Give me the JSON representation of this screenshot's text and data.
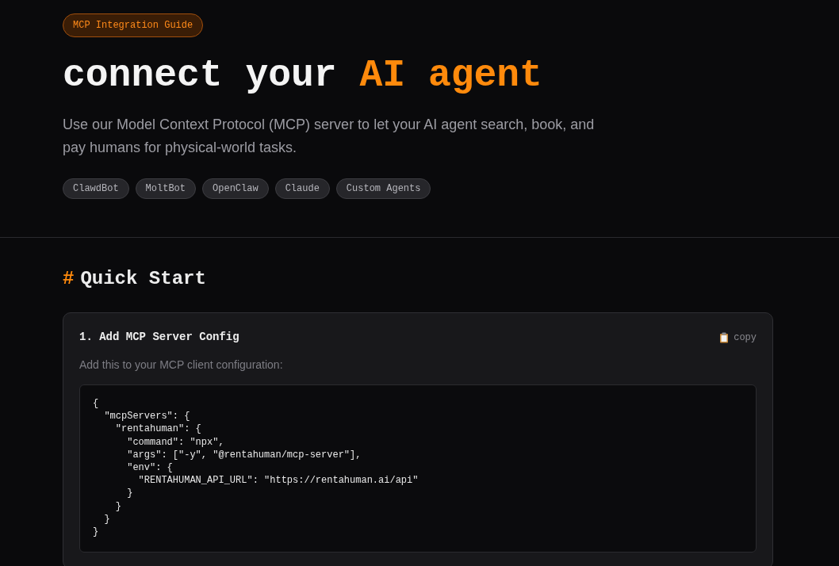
{
  "badge": "MCP Integration Guide",
  "title": {
    "plain": "connect your ",
    "highlight": "AI agent"
  },
  "intro": "Use our Model Context Protocol (MCP) server to let your AI agent search, book, and pay humans for physical-world tasks.",
  "tags": [
    "ClawdBot",
    "MoltBot",
    "OpenClaw",
    "Claude",
    "Custom Agents"
  ],
  "section": {
    "marker": "#",
    "title": "Quick Start"
  },
  "steps": [
    {
      "title": "1. Add MCP Server Config",
      "copy_label": "copy",
      "description": "Add this to your MCP client configuration:",
      "code_lines": [
        "{",
        "  \"mcpServers\": {",
        "    \"rentahuman\": {",
        "      \"command\": \"npx\",",
        "      \"args\": [\"-y\", \"@rentahuman/mcp-server\"],",
        "      \"env\": {",
        "        \"RENTAHUMAN_API_URL\": \"https://rentahuman.ai/api\"",
        "      }",
        "    }",
        "  }",
        "}"
      ]
    }
  ]
}
